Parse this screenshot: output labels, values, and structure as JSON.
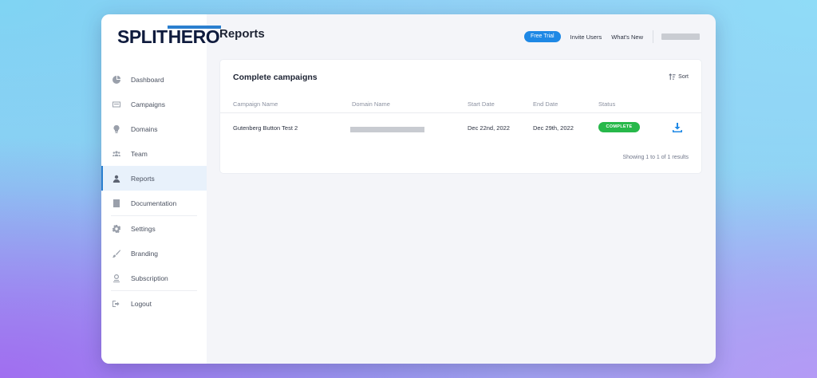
{
  "brand": {
    "logo_part1": "SPLIT",
    "logo_part2": "HERO",
    "accent": "#2a7fcf",
    "navy": "#0f1b3d"
  },
  "sidebar": {
    "items": [
      {
        "label": "Dashboard",
        "icon": "pie-chart-icon",
        "active": false
      },
      {
        "label": "Campaigns",
        "icon": "campaigns-icon",
        "active": false
      },
      {
        "label": "Domains",
        "icon": "lightbulb-icon",
        "active": false
      },
      {
        "label": "Team",
        "icon": "team-icon",
        "active": false
      },
      {
        "label": "Reports",
        "icon": "user-report-icon",
        "active": true
      },
      {
        "label": "Documentation",
        "icon": "book-icon",
        "active": false
      },
      {
        "label": "Settings",
        "icon": "gear-icon",
        "active": false
      },
      {
        "label": "Branding",
        "icon": "brush-icon",
        "active": false
      },
      {
        "label": "Subscription",
        "icon": "subscription-icon",
        "active": false
      },
      {
        "label": "Logout",
        "icon": "logout-icon",
        "active": false
      }
    ]
  },
  "header": {
    "title": "Reports",
    "free_trial_label": "Free Trial",
    "invite_users_label": "Invite Users",
    "whats_new_label": "What's New"
  },
  "card": {
    "title": "Complete campaigns",
    "sort_label": "Sort",
    "columns": [
      "Campaign Name",
      "Domain Name",
      "Start Date",
      "End Date",
      "Status"
    ],
    "rows": [
      {
        "campaign_name": "Gutenberg Button Test 2",
        "start_date": "Dec 22nd, 2022",
        "end_date": "Dec 29th, 2022",
        "status": "COMPLETE",
        "status_color": "#27b84a"
      }
    ],
    "showing_text": "Showing 1 to 1 of 1 results"
  }
}
